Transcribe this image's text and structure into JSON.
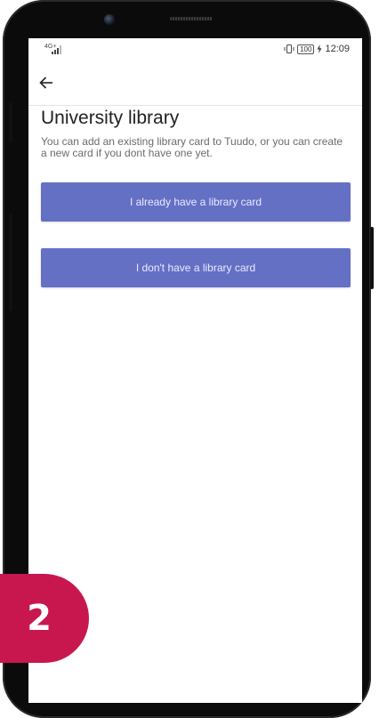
{
  "status_bar": {
    "network": "4G+",
    "battery": "100",
    "time": "12:09"
  },
  "app_bar": {
    "back_icon": "arrow-left-icon"
  },
  "page": {
    "title": "University library",
    "description": "You can add an existing library card to Tuudo, or you can create a new card if you dont have one yet."
  },
  "buttons": {
    "have_card": "I already have a library card",
    "no_card": "I don't have a library card"
  },
  "step_badge": {
    "number": "2"
  },
  "colors": {
    "button_bg": "#6470c4",
    "badge_bg": "#c8174f"
  }
}
